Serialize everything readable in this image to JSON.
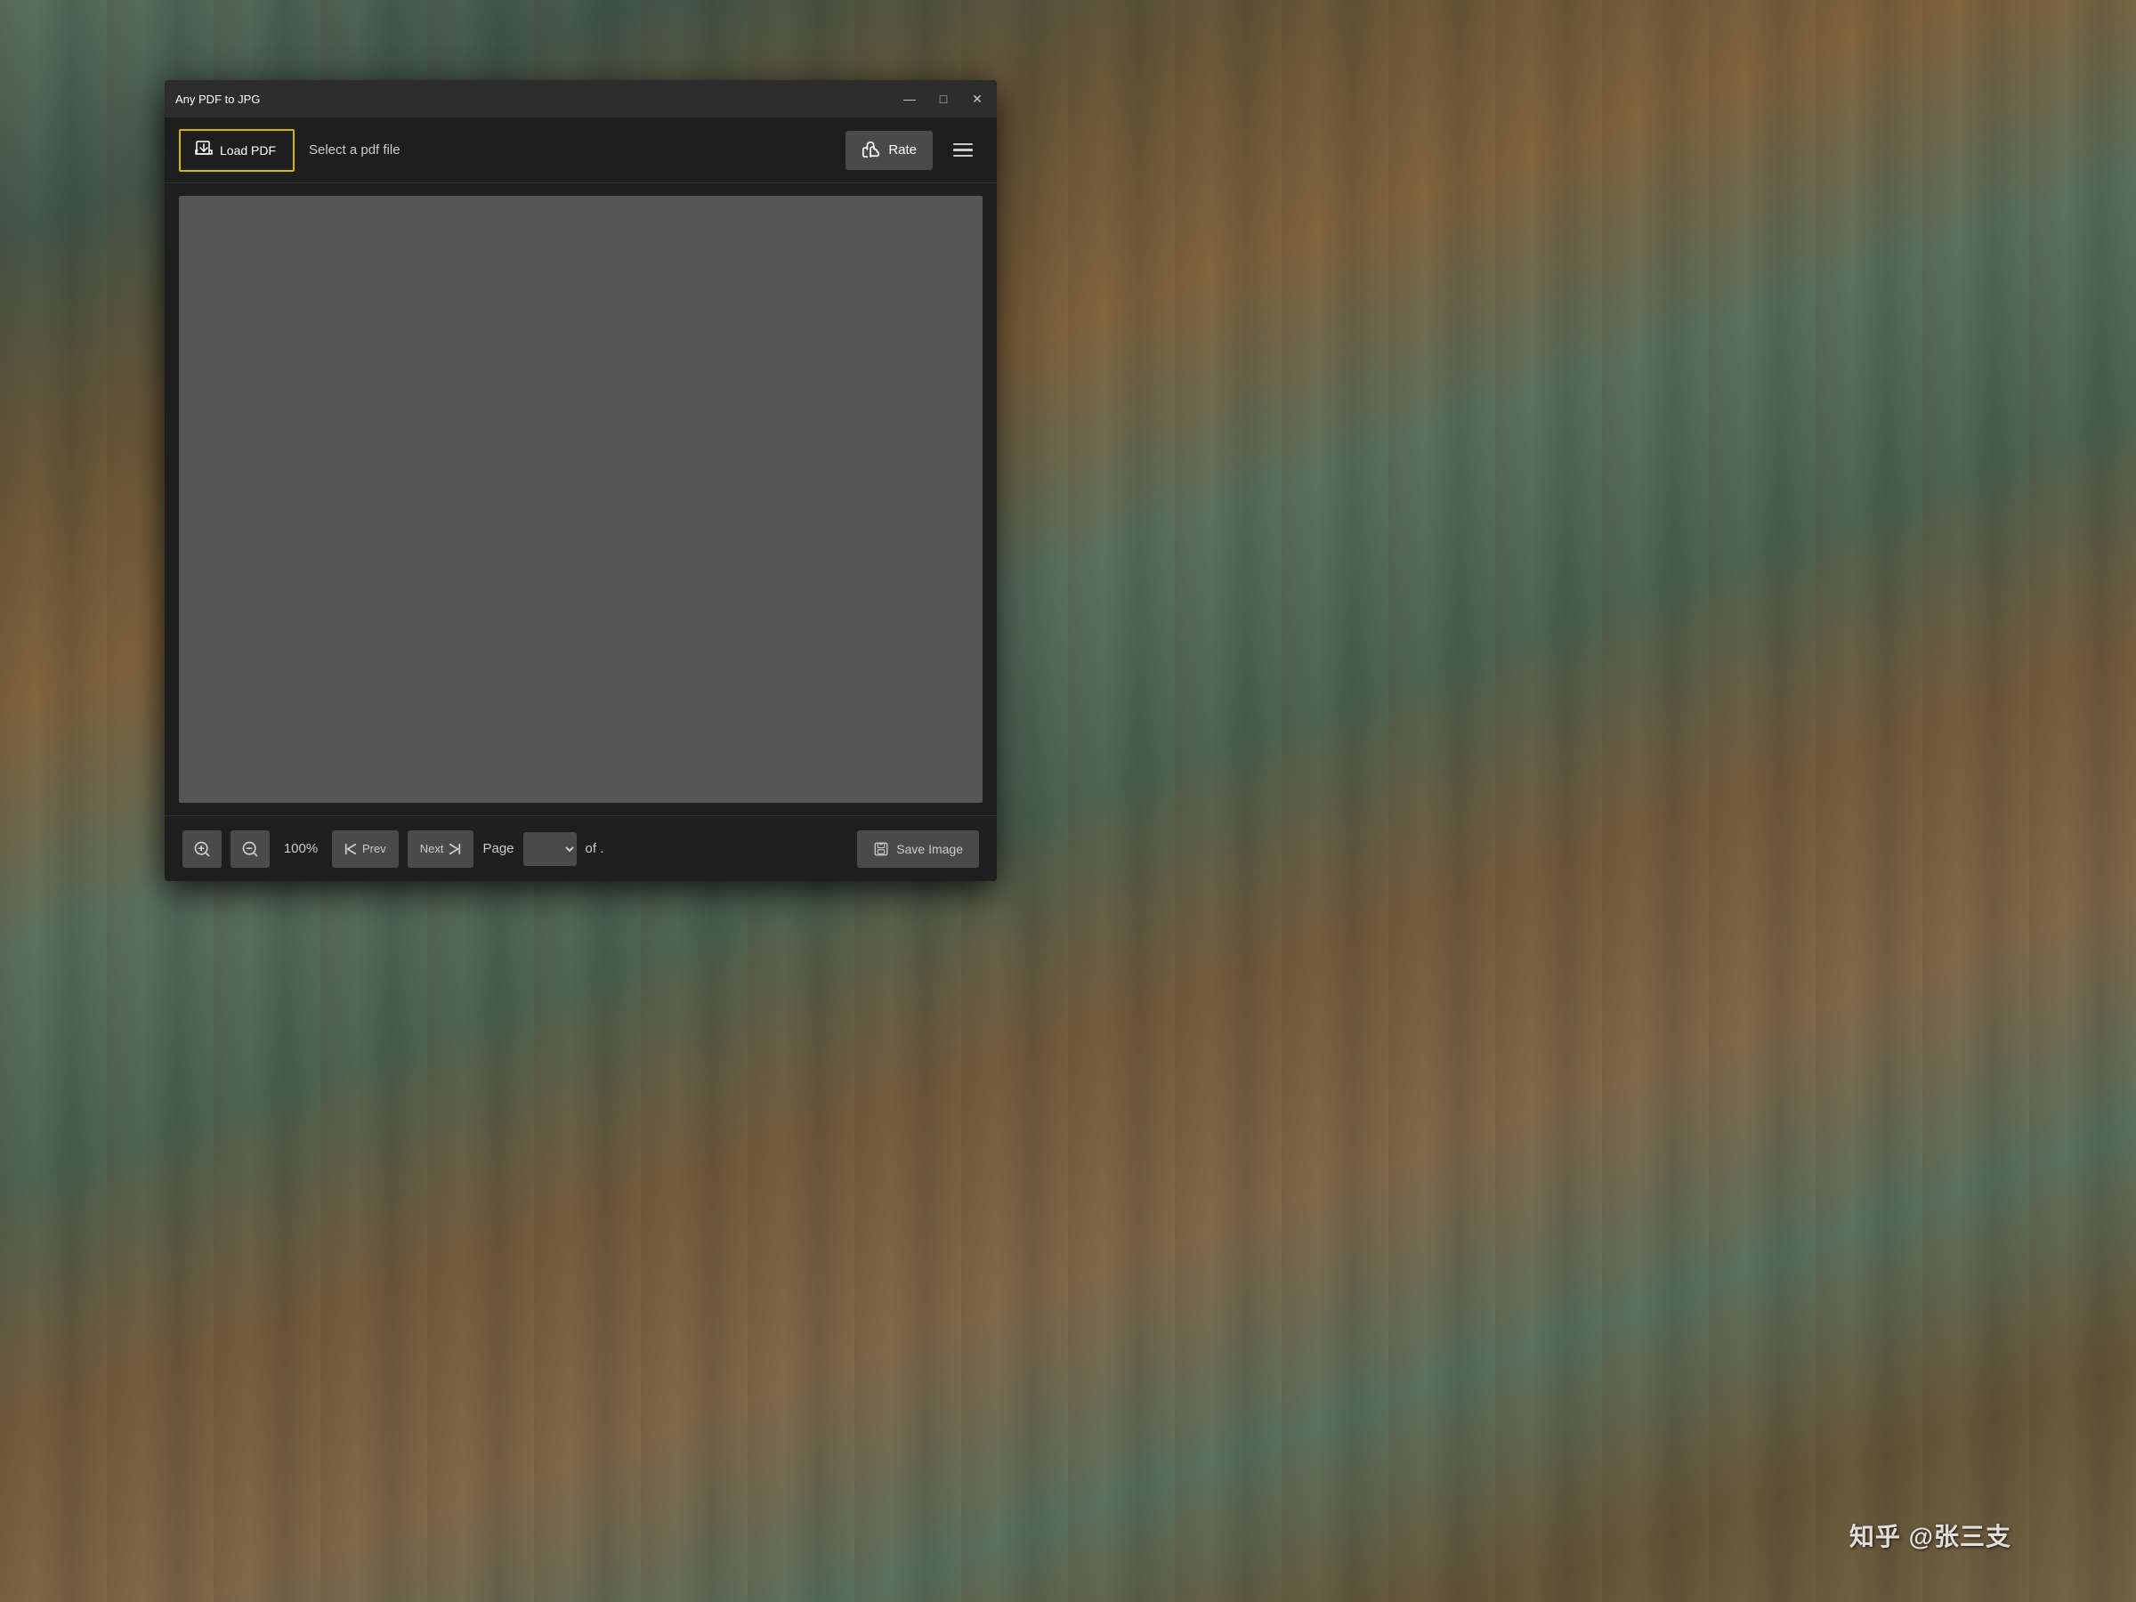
{
  "background": {
    "color": "#5a7060"
  },
  "titleBar": {
    "title": "Any PDF to JPG",
    "minimizeIcon": "—",
    "maximizeIcon": "□",
    "closeIcon": "✕"
  },
  "toolbar": {
    "loadPdfLabel": "Load PDF",
    "fileHint": "Select a pdf file",
    "rateLabel": "Rate",
    "thumbIcon": "👍"
  },
  "bottomBar": {
    "zoomInIcon": "⊕",
    "zoomOutIcon": "⊖",
    "zoomLevel": "100%",
    "prevLabel": "Prev",
    "nextLabel": "Next",
    "pageLabel": "Page",
    "ofLabel": "of .",
    "saveLabel": "Save Image",
    "prevIcon": "⏮",
    "nextIcon": "⏭",
    "saveIcon": "💾"
  },
  "watermark": {
    "text": "知乎 @张三支"
  }
}
